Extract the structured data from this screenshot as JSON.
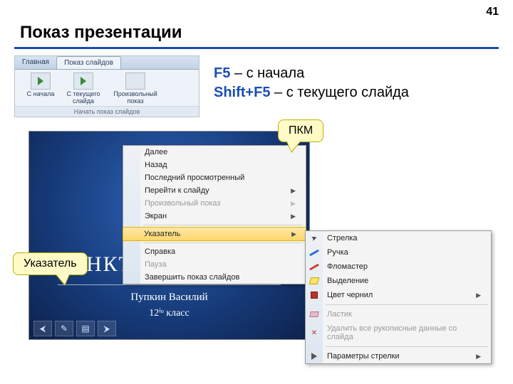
{
  "page_number": "41",
  "title": "Показ презентации",
  "ribbon": {
    "tab_home": "Главная",
    "tab_slideshow": "Показ слайдов",
    "btn_from_start": "С начала",
    "btn_from_current": "С текущего слайда",
    "btn_custom": "Произвольный показ",
    "group_label": "Начать показ слайдов"
  },
  "shortcuts": {
    "f5_key": "F5",
    "f5_text": " – с начала",
    "shift_f5_key": "Shift+F5",
    "shift_f5_text": " – с текущего слайда"
  },
  "callout_pkm": "ПКМ",
  "callout_ptr": "Указатель",
  "slide": {
    "mid": "НКТ",
    "name": "Пупкин Василий",
    "class": "12ⁱᵒ класс"
  },
  "menu": {
    "next": "Далее",
    "back": "Назад",
    "last_viewed": "Последний просмотренный",
    "goto_slide": "Перейти к слайду",
    "custom_show": "Произвольный показ",
    "screen": "Экран",
    "pointer": "Указатель",
    "help": "Справка",
    "pause": "Пауза",
    "end_show": "Завершить показ слайдов"
  },
  "submenu": {
    "arrow": "Стрелка",
    "pen": "Ручка",
    "felt": "Фломастер",
    "highlight": "Выделение",
    "ink_color": "Цвет чернил",
    "eraser": "Ластик",
    "erase_all": "Удалить все рукописные данные со слайда",
    "arrow_opts": "Параметры стрелки"
  }
}
